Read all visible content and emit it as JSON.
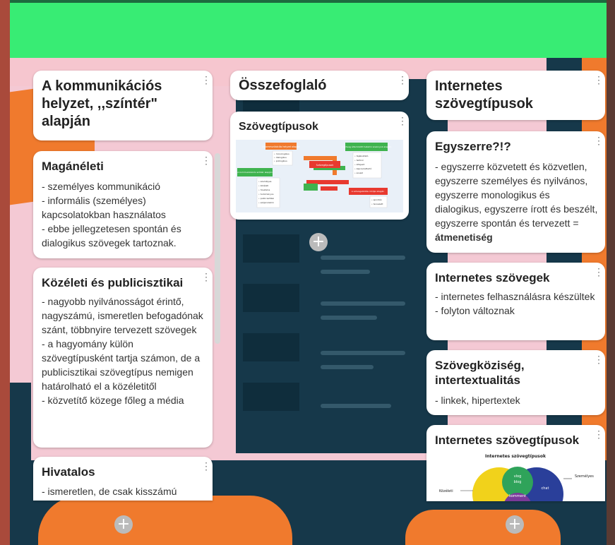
{
  "colors": {
    "banner": "#38ec74",
    "canvas": "#f4c9d4",
    "dark": "#16384a",
    "orange": "#f07a2d",
    "card": "#ffffff"
  },
  "columns": [
    {
      "title": "A kommunikációs helyzet, ,,színtér\" alapján",
      "cards": [
        {
          "title": "Magánéleti",
          "body": "- személyes kommunikáció\n-  informális (személyes) kapcsolatokban használatos\n- ebbe jellegzetesen spontán és dialogikus szövegek tartoznak."
        },
        {
          "title": "Közéleti és publicisztikai",
          "body": "- nagyobb nyilvánosságot érintő, nagyszámú, ismeretlen befogadónak szánt, többnyire tervezett szövegek\n-  a hagyomány külön szövegtípusként tartja számon, de a publicisztikai szövegtípus nemigen határolható el a közéletitől\n- közvetítő közege főleg a média"
        },
        {
          "title": "Hivatalos",
          "body": "- ismeretlen, de csak kisszámú"
        }
      ],
      "add_label": "+"
    },
    {
      "title": "Összefoglaló",
      "cards": [
        {
          "title": "Szövegtípusok",
          "diagram": {
            "boxes": [
              "A kommunikációs helyzet alapján",
              "A szöveg által közölt hatalmi viszonyok alapján",
              "Szövegtípusok",
              "A kommunikációs színtér alapján",
              "A szövegalkotás módja alapján"
            ],
            "lists": [
              [
                "• monologikus",
                "• dialogikus",
                "• polilogikus"
              ],
              [
                "• tájékoztató",
                "• felhívó",
                "• kifejező",
                "• kapcsolattartó",
                "• érvelő"
              ],
              [
                "• személyes",
                "• közéleti",
                "• hivatalos",
                "• tudományos",
                "• publicisztikai",
                "• szépirodalmi"
              ],
              [
                "• spontán",
                "• tervezett"
              ]
            ]
          }
        }
      ],
      "add_label": "+"
    },
    {
      "title": "Internetes szövegtípusok",
      "cards": [
        {
          "title": "Egyszerre?!?",
          "body": "- egyszerre közvetett és közvetlen, egyszerre személyes és nyilvános, egyszerre monologikus és dialogikus, egyszerre írott és beszélt, egyszerre spontán és tervezett = ",
          "body_bold": "átmenetiség"
        },
        {
          "title": "Internetes szövegek",
          "body": "- internetes felhasználásra készültek\n- folyton változnak"
        },
        {
          "title": "Szövegköziség, intertextualitás",
          "body": "- linkek, hipertextek"
        },
        {
          "title": "Internetes szövegtípusok",
          "venn": {
            "title": "Internetes szövegtípusok",
            "left_label": "Közéleti",
            "right_label": "Személyes",
            "center_labels": [
              "vlog",
              "blog"
            ],
            "right_inner": "chat",
            "bottom_inner": "komment"
          }
        }
      ],
      "add_label": "+"
    }
  ]
}
